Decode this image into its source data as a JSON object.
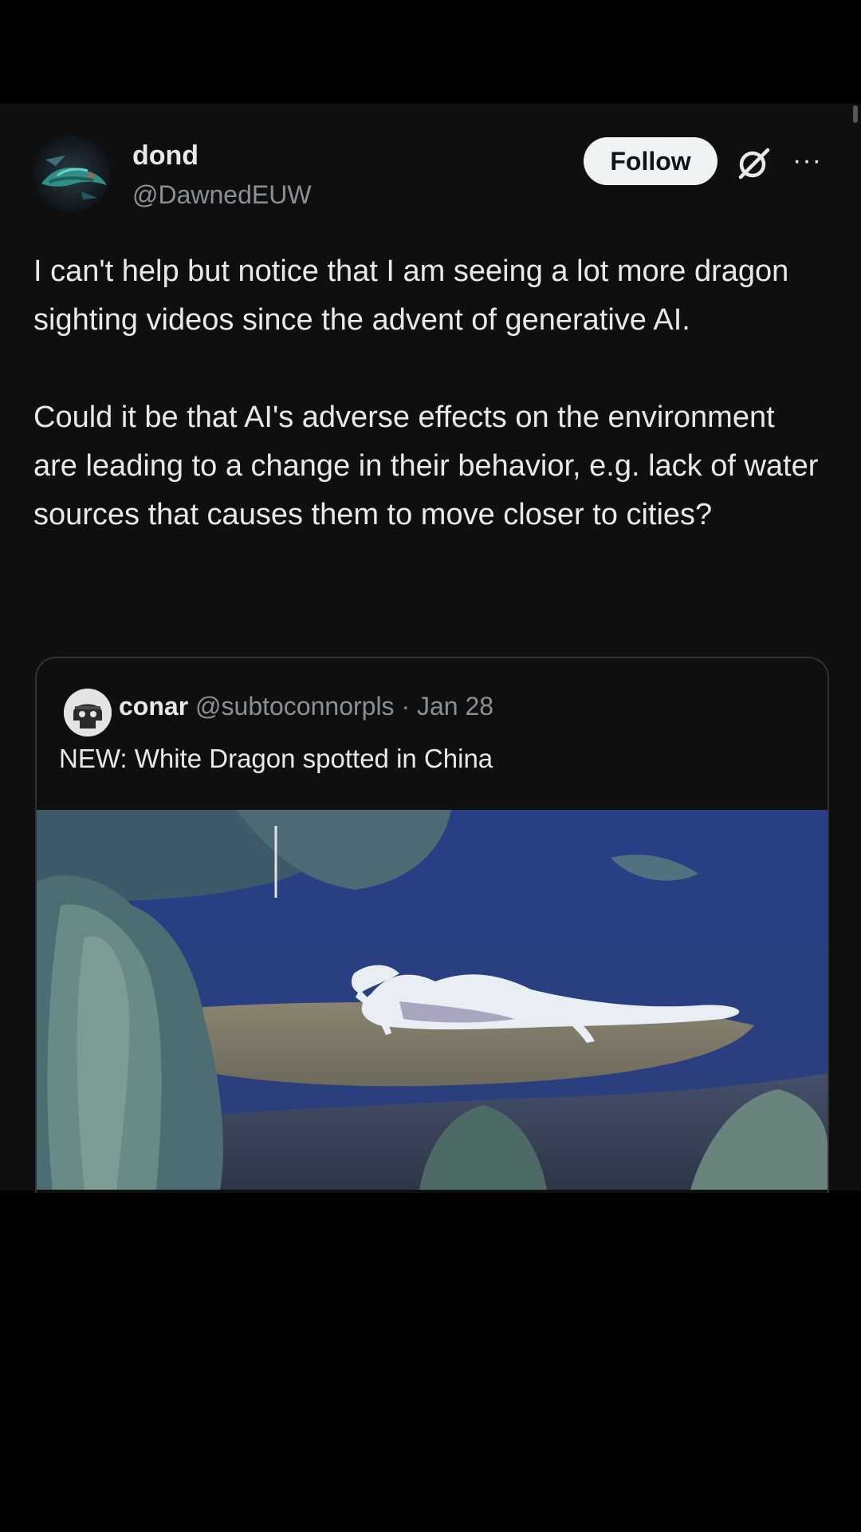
{
  "post": {
    "author_name": "dond",
    "author_handle": "@DawnedEUW",
    "follow_label": "Follow",
    "more_icon": "···",
    "paragraphs": [
      "I can't help but notice that I am seeing a lot more dragon sighting videos since the advent of generative AI.",
      "Could it be that AI's adverse effects on the environment are leading to a change in their behavior, e.g. lack of water sources that causes them to move closer to cities?"
    ]
  },
  "quote": {
    "author_name": "conar",
    "author_handle": "@subtoconnorpls",
    "separator": " · ",
    "date": "Jan 28",
    "text": "NEW: White Dragon spotted in China"
  },
  "icons": {
    "avatar": "dragon-avatar",
    "grok": "grok-icon",
    "more": "more-icon",
    "quote_avatar": "skull-avatar"
  },
  "colors": {
    "background": "#000000",
    "card": "#0f0f10",
    "text": "#e7e9ea",
    "secondary_text": "#8b9095",
    "follow_bg": "#eff3f4",
    "border": "#2f3336"
  }
}
